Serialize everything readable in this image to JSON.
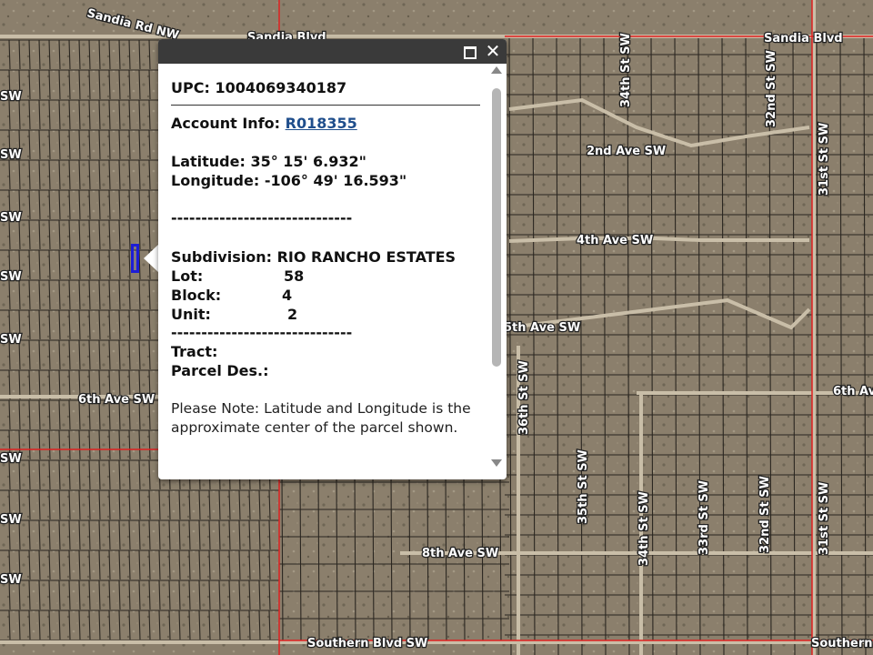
{
  "map": {
    "street_labels": [
      {
        "id": "sandia-rd-nw",
        "text": "Sandia Rd NW"
      },
      {
        "id": "sandia-blvd-1",
        "text": "Sandia Blvd"
      },
      {
        "id": "sandia-blvd-2",
        "text": "Sandia Blvd"
      },
      {
        "id": "2nd-ave-sw",
        "text": "2nd Ave SW"
      },
      {
        "id": "4th-ave-sw",
        "text": "4th Ave SW"
      },
      {
        "id": "5th-ave-sw",
        "text": "5th Ave SW"
      },
      {
        "id": "6th-ave-sw-1",
        "text": "6th Ave SW"
      },
      {
        "id": "6th-ave-sw-2",
        "text": "6th Ave"
      },
      {
        "id": "8th-ave-sw",
        "text": "8th Ave SW"
      },
      {
        "id": "southern-blvd-sw-1",
        "text": "Southern Blvd SW"
      },
      {
        "id": "southern-blvd-2",
        "text": "Southern"
      },
      {
        "id": "34th-st-sw-1",
        "text": "34th St SW"
      },
      {
        "id": "32nd-st-sw-1",
        "text": "32nd St SW"
      },
      {
        "id": "31st-st-sw-1",
        "text": "31st St SW"
      },
      {
        "id": "36th-st-sw",
        "text": "36th St SW"
      },
      {
        "id": "35th-st-sw",
        "text": "35th St SW"
      },
      {
        "id": "34th-st-sw-2",
        "text": "34th St SW"
      },
      {
        "id": "33rd-st-sw",
        "text": "33rd St SW"
      },
      {
        "id": "32nd-st-sw-2",
        "text": "32nd St SW"
      },
      {
        "id": "31st-st-sw-2",
        "text": "31st St SW"
      },
      {
        "id": "sw-1",
        "text": "SW"
      },
      {
        "id": "sw-2",
        "text": "SW"
      },
      {
        "id": "sw-3",
        "text": "SW"
      },
      {
        "id": "sw-4",
        "text": "SW"
      },
      {
        "id": "sw-5",
        "text": "SW"
      },
      {
        "id": "sw-6",
        "text": "SW"
      },
      {
        "id": "sw-7",
        "text": "SW"
      },
      {
        "id": "sw-8",
        "text": "SW"
      }
    ],
    "highlight_color": "#1d1dd6",
    "boundary_color": "#e02020"
  },
  "popup": {
    "upc_label": "UPC:",
    "upc_value": "1004069340187",
    "account_label": "Account Info:",
    "account_value": "R018355",
    "latitude_label": "Latitude:",
    "latitude_value": "35° 15' 6.932\"",
    "longitude_label": "Longitude:",
    "longitude_value": "-106° 49' 16.593\"",
    "separator_1": "------------------------------",
    "subdivision_label": "Subdivision:",
    "subdivision_value": "RIO RANCHO ESTATES",
    "lot_label": "Lot:",
    "lot_value": "58",
    "block_label": "Block:",
    "block_value": "4",
    "unit_label": "Unit:",
    "unit_value": "2",
    "separator_2": "------------------------------",
    "tract_label": "Tract:",
    "tract_value": "",
    "parcel_des_label": "Parcel Des.:",
    "parcel_des_value": "",
    "note": "Please Note: Latitude and Longitude is the approximate center of the parcel shown.",
    "maximize_icon": "maximize-icon",
    "close_icon": "close-icon",
    "close_glyph": "✕"
  }
}
